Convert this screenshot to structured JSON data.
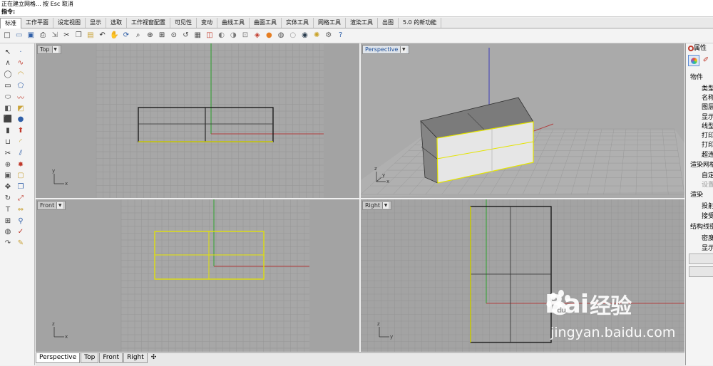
{
  "status": {
    "text": "正在建立网格... 按 Esc 取消"
  },
  "command": {
    "label": "指令:"
  },
  "tabs": [
    "标准",
    "工作平面",
    "设定视图",
    "显示",
    "选取",
    "工作视窗配置",
    "可见性",
    "变动",
    "曲线工具",
    "曲面工具",
    "实体工具",
    "网格工具",
    "渲染工具",
    "出图",
    "5.0 的新功能"
  ],
  "active_tab": "标准",
  "toolbar_icons": [
    "new-icon",
    "open-icon",
    "save-icon",
    "print-icon",
    "import-icon",
    "cut-icon",
    "copy-icon",
    "paste-icon",
    "undo-icon",
    "pan-icon",
    "rotate-view-icon",
    "zoom-icon",
    "zoom-window-icon",
    "zoom-extents-icon",
    "zoom-selected-icon",
    "undo-view-icon",
    "four-viewports-icon",
    "cplane-icon",
    "hide-icon",
    "show-icon",
    "lock-icon",
    "layer-icon",
    "render-color-icon",
    "material-icon",
    "render-preview-icon",
    "render-icon",
    "light-icon",
    "options-icon",
    "help-icon"
  ],
  "left_tool_icons": [
    "select-arrow-icon",
    "point-icon",
    "polyline-icon",
    "curve-icon",
    "circle-icon",
    "arc-icon",
    "rectangle-icon",
    "polygon-icon",
    "ellipse-icon",
    "freeform-icon",
    "surface-icon",
    "loft-icon",
    "box-icon",
    "sphere-icon",
    "cylinder-icon",
    "extrude-icon",
    "boolean-union-icon",
    "fillet-icon",
    "trim-icon",
    "split-icon",
    "join-icon",
    "explode-icon",
    "group-icon",
    "ungroup-icon",
    "move-icon",
    "copy-object-icon",
    "rotate-icon",
    "scale-icon",
    "text-icon",
    "dimension-icon",
    "mesh-icon",
    "analyze-icon",
    "render-object-icon",
    "check-icon",
    "sweep-icon",
    "paint-icon"
  ],
  "viewports": {
    "top": {
      "label": "Top",
      "axis_y": "y",
      "axis_x": "x"
    },
    "perspective": {
      "label": "Perspective",
      "axis_y": "z",
      "axis_x": "x",
      "axis_z": "y"
    },
    "front": {
      "label": "Front",
      "axis_y": "z",
      "axis_x": "x"
    },
    "right": {
      "label": "Right",
      "axis_y": "z",
      "axis_x": "y"
    }
  },
  "viewport_tabs": [
    "Perspective",
    "Top",
    "Front",
    "Right"
  ],
  "active_viewport_tab": "Perspective",
  "add_tab_symbol": "✣",
  "right_panel": {
    "tab": "属性",
    "sections": {
      "object": "物件",
      "render_mesh": "渲染网格",
      "render": "渲染",
      "isocurves": "结构线密度"
    },
    "rows": [
      "类型",
      "名称",
      "图层",
      "显示",
      "线型",
      "打印",
      "打印",
      "超连",
      "自定",
      "设置",
      "投射",
      "接受",
      "密度",
      "显示"
    ]
  },
  "watermark": {
    "brand": "Bai",
    "brand2": "du",
    "cn": "经验",
    "url": "jingyan.baidu.com"
  },
  "colors": {
    "viewport_bg": "#a3a3a3",
    "grid": "#959595",
    "x_axis": "#b13f3f",
    "y_axis": "#2ea32e",
    "z_axis": "#3a3ab8",
    "selection": "#e4e400",
    "curve": "#111111"
  }
}
